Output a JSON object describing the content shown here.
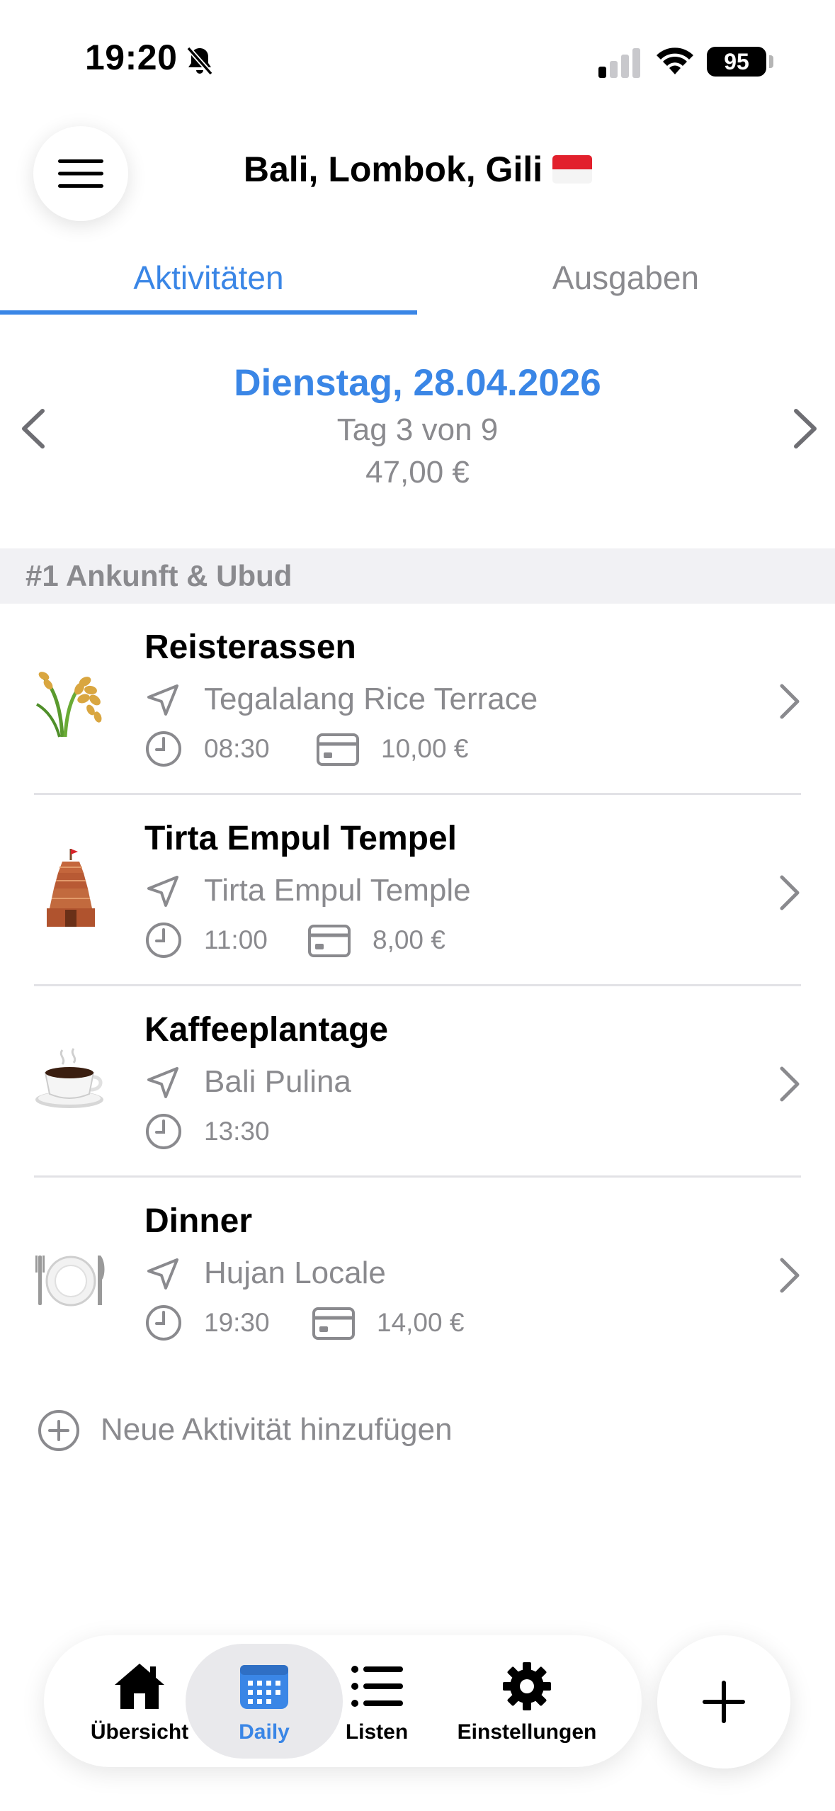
{
  "status_bar": {
    "time": "19:20",
    "battery": "95",
    "icons": [
      "bell-slash-icon",
      "cellular-signal-icon",
      "wifi-icon",
      "battery-icon"
    ]
  },
  "header": {
    "title": "Bali, Lombok, Gili",
    "flag": "Indonesia flag",
    "menu_icon": "hamburger-menu-icon"
  },
  "tabs": [
    {
      "label": "Aktivitäten",
      "active": true
    },
    {
      "label": "Ausgaben",
      "active": false
    }
  ],
  "day_nav": {
    "date": "Dienstag, 28.04.2026",
    "day_counter": "Tag 3 von 9",
    "total": "47,00 €"
  },
  "section": {
    "title": "#1 Ankunft & Ubud"
  },
  "activities": [
    {
      "title": "Reisterassen",
      "emoji": "rice-plant",
      "location": "Tegalalang Rice Terrace",
      "time": "08:30",
      "cost": "10,00 €"
    },
    {
      "title": "Tirta Empul Tempel",
      "emoji": "temple",
      "location": "Tirta Empul Temple",
      "time": "11:00",
      "cost": "8,00 €"
    },
    {
      "title": "Kaffeeplantage",
      "emoji": "coffee-cup",
      "location": "Bali Pulina",
      "time": "13:30",
      "cost": ""
    },
    {
      "title": "Dinner",
      "emoji": "plate-fork-knife",
      "location": "Hujan Locale",
      "time": "19:30",
      "cost": "14,00 €"
    }
  ],
  "add_activity": {
    "label": "Neue Aktivität hinzufügen"
  },
  "tab_bar": {
    "items": [
      {
        "label": "Übersicht",
        "icon": "house-icon",
        "active": false
      },
      {
        "label": "Daily",
        "icon": "calendar-icon",
        "active": true
      },
      {
        "label": "Listen",
        "icon": "list-icon",
        "active": false
      },
      {
        "label": "Einstellungen",
        "icon": "gear-icon",
        "active": false
      }
    ],
    "fab_icon": "plus-icon"
  },
  "colors": {
    "accent": "#3a86e6",
    "secondary_text": "#8a8a8e",
    "section_bg": "#f1f1f4"
  }
}
